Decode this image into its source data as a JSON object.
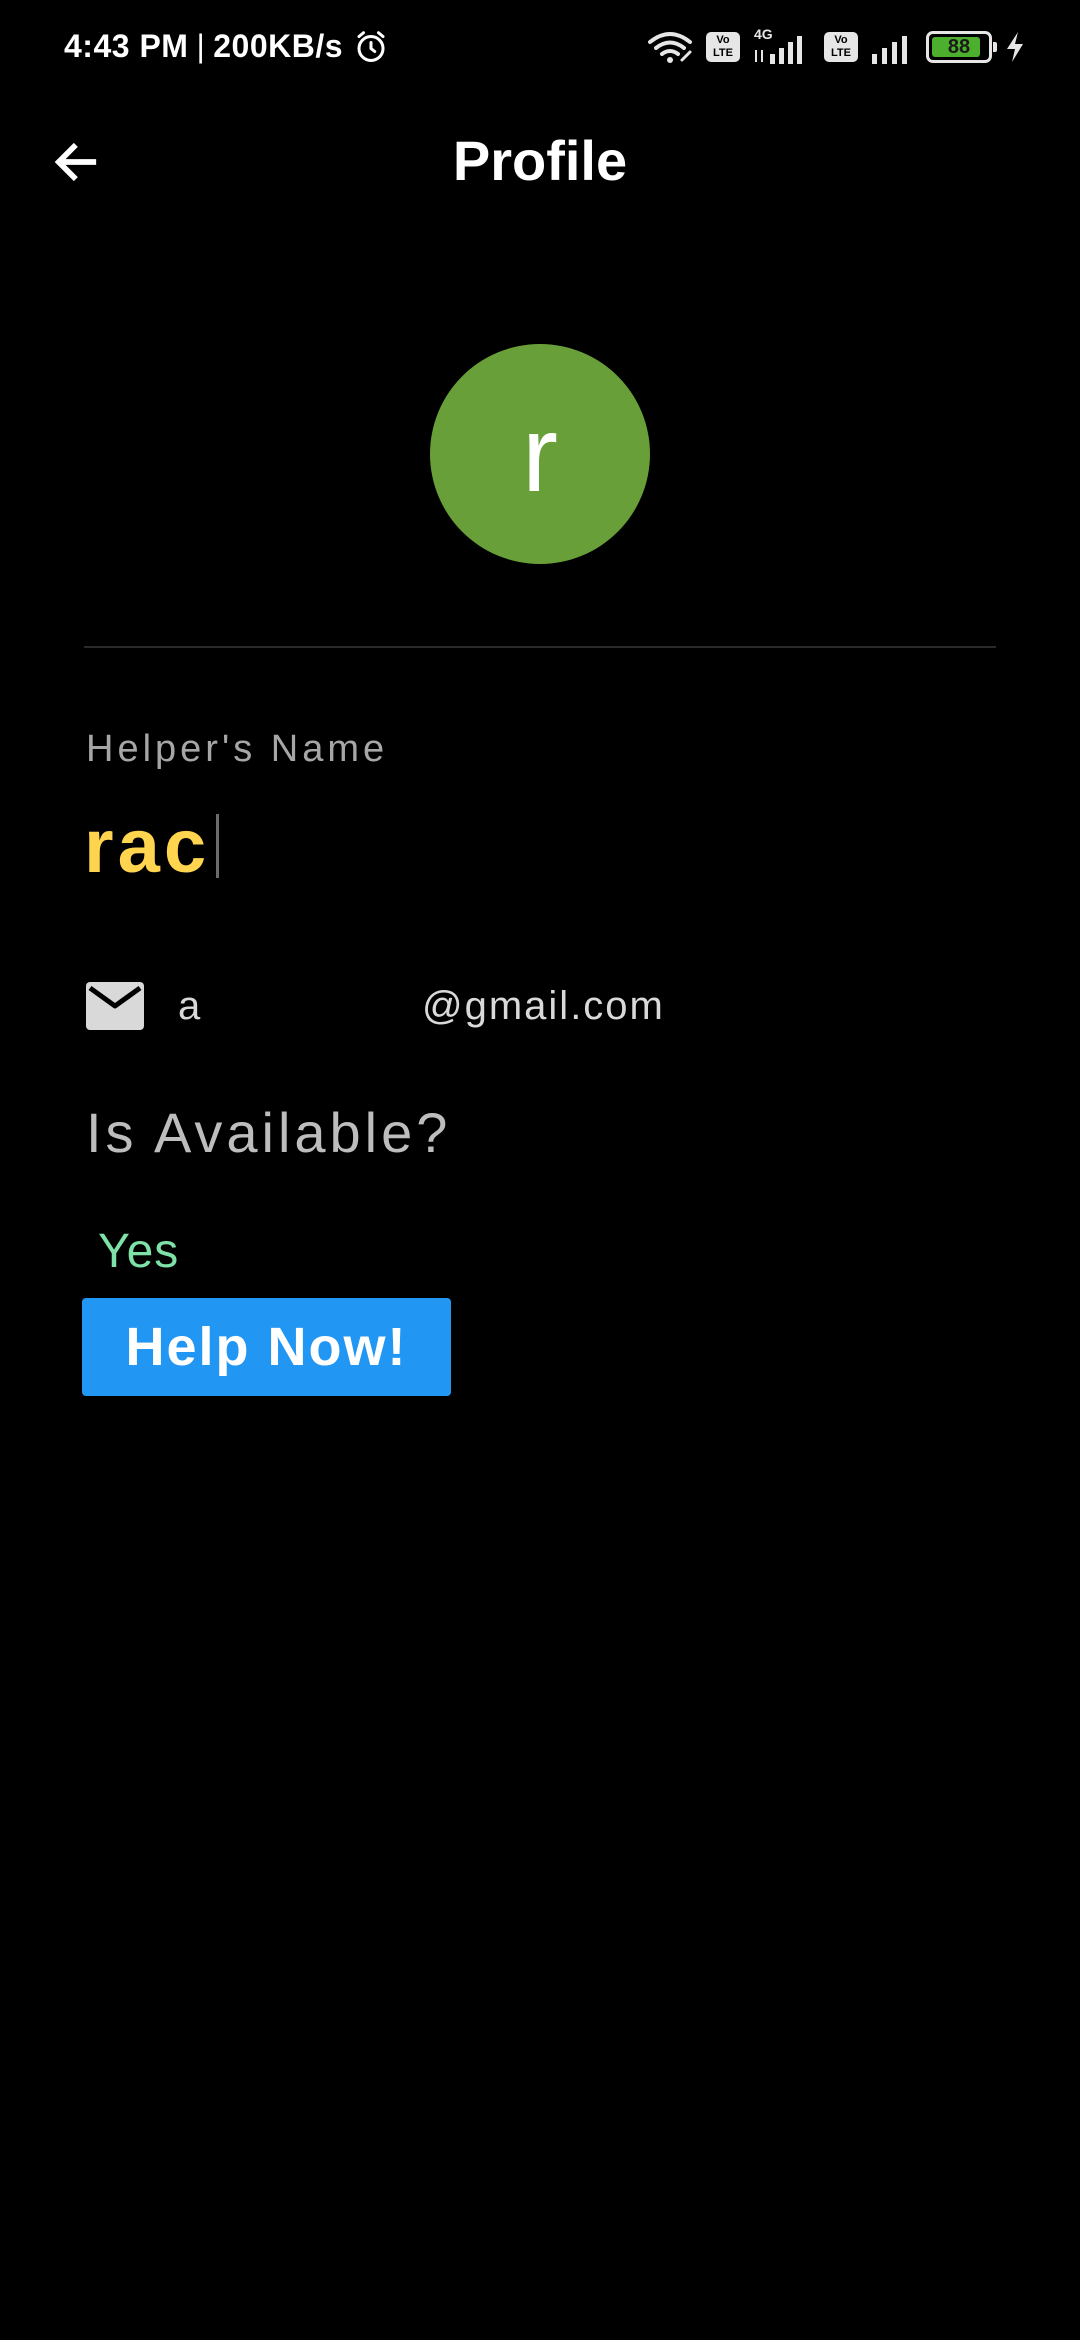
{
  "status_bar": {
    "time": "4:43 PM",
    "separator": "|",
    "network_speed": "200KB/s",
    "icons": [
      "alarm-icon",
      "wifi-icon",
      "volte-icon",
      "signal-icon",
      "volte-icon",
      "signal-icon",
      "battery-icon",
      "charging-icon"
    ],
    "volte_label_top": "Vo",
    "volte_label_bottom": "LTE",
    "network_type": "4G",
    "battery_level": "88",
    "battery_fill_fraction": 0.88
  },
  "app_bar": {
    "title": "Profile",
    "back_icon": "arrow-left-icon"
  },
  "profile": {
    "avatar_initial": "r",
    "avatar_color": "#689f38",
    "name_label": "Helper's Name",
    "name_value": "rac",
    "name_color": "#ffd54f",
    "email_icon": "mail-icon",
    "email_local": "a",
    "email_domain": "@gmail.com",
    "available_label": "Is Available?",
    "available_value": "Yes",
    "available_color": "#7ee2a8"
  },
  "actions": {
    "help_button_label": "Help Now!",
    "help_button_color": "#2196f3"
  }
}
